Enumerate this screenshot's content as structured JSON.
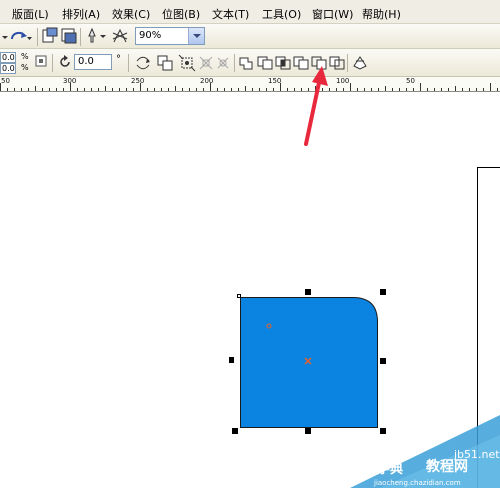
{
  "menu": {
    "items": [
      "版面(L)",
      "排列(A)",
      "效果(C)",
      "位图(B)",
      "文本(T)",
      "工具(O)",
      "窗口(W)",
      "帮助(H)"
    ]
  },
  "toolbar": {
    "zoom_value": "90%",
    "size_field_1": "0.0",
    "size_field_2": "0.0",
    "percent_1": "%",
    "percent_2": "%",
    "rotation_value": "0.0",
    "degree_symbol": "°"
  },
  "ruler": {
    "labels": [
      "50",
      "300",
      "250",
      "200",
      "150",
      "100",
      "50"
    ]
  },
  "shape": {
    "fill_color": "#0a84e0",
    "outline_color": "#1a1a1a",
    "center_marker_color": "#e8602c"
  },
  "watermark": {
    "site": "jb51.net",
    "brand_1": "查字典",
    "brand_2": "教程网",
    "url": "jiaocheng.chazidian.com"
  },
  "colors": {
    "accent_arrow": "#e8283c",
    "toolbar_bg": "#ece9d8"
  }
}
